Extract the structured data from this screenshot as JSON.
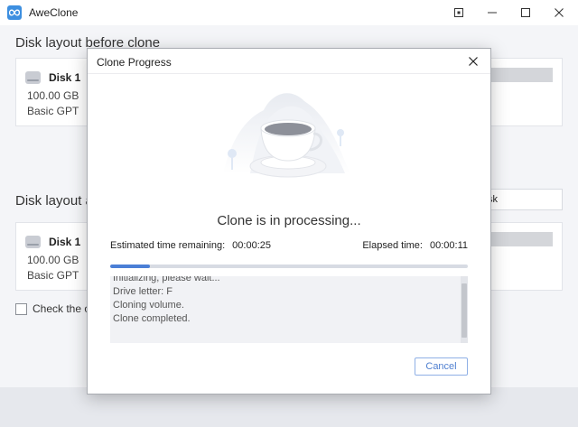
{
  "app": {
    "title": "AweClone",
    "logo_icon": "infinity-icon",
    "accent_color": "#3d8fe0"
  },
  "window_controls": {
    "restore_icon": "pin-window-icon",
    "minimize_icon": "minimize-icon",
    "maximize_icon": "maximize-icon",
    "close_icon": "close-icon"
  },
  "sections": {
    "before_title": "Disk layout before clone",
    "after_title": "Disk layout a"
  },
  "disks": {
    "source": {
      "name": "Disk 1",
      "size": "100.00 GB",
      "type": "Basic GPT"
    },
    "target": {
      "name": "Disk 1",
      "size": "100.00 GB",
      "type": "Basic GPT"
    }
  },
  "target_select": {
    "value": "sk"
  },
  "checkbox": {
    "label": "Check the op",
    "checked": false
  },
  "modal": {
    "title": "Clone Progress",
    "status": "Clone is in processing...",
    "estimated_label": "Estimated time remaining:",
    "estimated_value": "00:00:25",
    "elapsed_label": "Elapsed time:",
    "elapsed_value": "00:00:11",
    "progress_fraction": 0.11,
    "progress_color": "#4b7fd6",
    "log": [
      "Initializing, please wait...",
      "Drive letter: F",
      "Cloning volume.",
      "Clone completed."
    ],
    "cancel_label": "Cancel"
  }
}
